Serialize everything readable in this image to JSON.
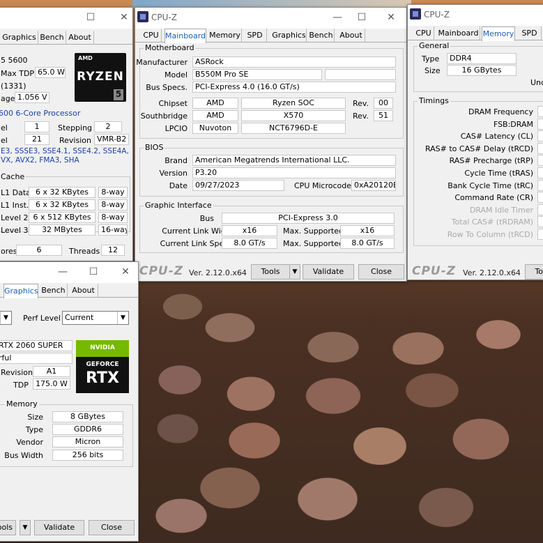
{
  "common": {
    "app_title": "CPU-Z",
    "logo": "CPU-Z",
    "version": "Ver. 2.12.0.x64",
    "tools": "Tools",
    "validate": "Validate",
    "close": "Close",
    "minimize": "—",
    "maximize": "☐",
    "close_x": "✕"
  },
  "cpu": {
    "tabs": [
      "Graphics",
      "Bench",
      "About"
    ],
    "name_frag": "5 5600",
    "max_tdp_label": "Max TDP",
    "max_tdp": "65.0 W",
    "rev_frag": "(1331)",
    "voltage_label_frag": "age",
    "voltage": "1.056 V",
    "spec_frag": "600 6-Core Processor",
    "family_frag": "el",
    "family": "1",
    "stepping_label": "Stepping",
    "stepping": "2",
    "model_frag": "el",
    "model": "21",
    "revision_label": "Revision",
    "revision": "VMR-B2",
    "instr1": "E3, SSSE3, SSE4.1, SSE4.2, SSE4A,",
    "instr2": "VX, AVX2, FMA3, SHA",
    "cache_title": "Cache",
    "cache": [
      {
        "label": "L1 Data",
        "size": "6 x 32 KBytes",
        "way": "8-way"
      },
      {
        "label": "L1 Inst.",
        "size": "6 x 32 KBytes",
        "way": "8-way"
      },
      {
        "label": "Level 2",
        "size": "6 x 512 KBytes",
        "way": "8-way"
      },
      {
        "label": "Level 3",
        "size": "32 MBytes",
        "way": "16-way"
      }
    ],
    "cores_frag": "ores",
    "cores": "6",
    "threads_label": "Threads",
    "threads": "12",
    "logo_brand": "AMD",
    "logo_text": "RYZEN",
    "logo_num": "5"
  },
  "mb": {
    "tabs": [
      "CPU",
      "Mainboard",
      "Memory",
      "SPD",
      "Graphics",
      "Bench",
      "About"
    ],
    "group_motherboard": "Motherboard",
    "manufacturer_label": "Manufacturer",
    "manufacturer": "ASRock",
    "model_label": "Model",
    "model": "B550M Pro SE",
    "busspecs_label": "Bus Specs.",
    "busspecs": "PCI-Express 4.0 (16.0 GT/s)",
    "chipset_label": "Chipset",
    "chipset_vendor": "AMD",
    "chipset_name": "Ryzen SOC",
    "chipset_rev_label": "Rev.",
    "chipset_rev": "00",
    "south_label": "Southbridge",
    "south_vendor": "AMD",
    "south_name": "X570",
    "south_rev_label": "Rev.",
    "south_rev": "51",
    "lpcio_label": "LPCIO",
    "lpcio_vendor": "Nuvoton",
    "lpcio_name": "NCT6796D-E",
    "group_bios": "BIOS",
    "brand_label": "Brand",
    "brand": "American Megatrends International LLC.",
    "version_label": "Version",
    "version": "P3.20",
    "date_label": "Date",
    "date": "09/27/2023",
    "microcode_label": "CPU Microcode",
    "microcode": "0xA20120E",
    "group_gi": "Graphic Interface",
    "bus_label": "Bus",
    "bus": "PCI-Express 3.0",
    "clw_label": "Current Link Width",
    "clw": "x16",
    "msw_label": "Max. Supported",
    "msw": "x16",
    "cls_label": "Current Link Speed",
    "cls": "8.0 GT/s",
    "mss_label": "Max. Supported",
    "mss": "8.0 GT/s"
  },
  "mem": {
    "tabs": [
      "CPU",
      "Mainboard",
      "Memory",
      "SPD"
    ],
    "group_general": "General",
    "type_label": "Type",
    "type": "DDR4",
    "size_label": "Size",
    "size": "16 GBytes",
    "unc_frag": "Unc",
    "group_timings": "Timings",
    "timings": [
      {
        "label": "DRAM Frequency",
        "grey": false
      },
      {
        "label": "FSB:DRAM",
        "grey": false
      },
      {
        "label": "CAS# Latency (CL)",
        "grey": false
      },
      {
        "label": "RAS# to CAS# Delay (tRCD)",
        "grey": false
      },
      {
        "label": "RAS# Precharge (tRP)",
        "grey": false
      },
      {
        "label": "Cycle Time (tRAS)",
        "grey": false
      },
      {
        "label": "Bank Cycle Time (tRC)",
        "grey": false
      },
      {
        "label": "Command Rate (CR)",
        "grey": false
      },
      {
        "label": "DRAM Idle Timer",
        "grey": true
      },
      {
        "label": "Total CAS# (tRDRAM)",
        "grey": true
      },
      {
        "label": "Row To Column (tRCD)",
        "grey": true
      }
    ]
  },
  "gpu": {
    "tabs": [
      "Graphics",
      "Bench",
      "About"
    ],
    "perf_label": "Perf Level",
    "perf_value": "Current",
    "name": "RTX 2060 SUPER",
    "codename_frag": "rful",
    "revision_label": "Revision",
    "revision": "A1",
    "tdp_label": "TDP",
    "tdp": "175.0 W",
    "group_memory": "Memory",
    "size_label": "Size",
    "size": "8 GBytes",
    "type_label": "Type",
    "type": "GDDR6",
    "vendor_label": "Vendor",
    "vendor": "Micron",
    "buswidth_label": "Bus Width",
    "buswidth": "256 bits",
    "logo_brand": "NVIDIA",
    "logo_line1": "GEFORCE",
    "logo_line2": "RTX"
  }
}
